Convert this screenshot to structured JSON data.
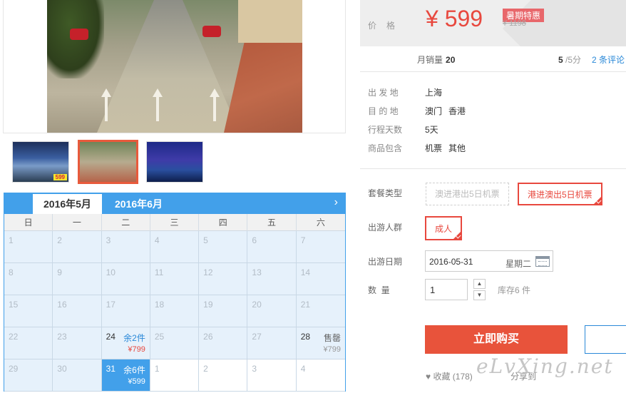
{
  "calendar": {
    "tabs": [
      "2016年5月",
      "2016年6月"
    ],
    "next_icon": "›",
    "weekdays": [
      "日",
      "一",
      "二",
      "三",
      "四",
      "五",
      "六"
    ],
    "cells": [
      {
        "d": "1"
      },
      {
        "d": "2"
      },
      {
        "d": "3"
      },
      {
        "d": "4"
      },
      {
        "d": "5"
      },
      {
        "d": "6"
      },
      {
        "d": "7"
      },
      {
        "d": "8"
      },
      {
        "d": "9"
      },
      {
        "d": "10"
      },
      {
        "d": "11"
      },
      {
        "d": "12"
      },
      {
        "d": "13"
      },
      {
        "d": "14"
      },
      {
        "d": "15"
      },
      {
        "d": "16"
      },
      {
        "d": "17"
      },
      {
        "d": "18"
      },
      {
        "d": "19"
      },
      {
        "d": "20"
      },
      {
        "d": "21"
      },
      {
        "d": "22"
      },
      {
        "d": "23"
      },
      {
        "d": "24",
        "stock": "余2件",
        "price": "¥799"
      },
      {
        "d": "25"
      },
      {
        "d": "26"
      },
      {
        "d": "27"
      },
      {
        "d": "28",
        "stock": "售罄",
        "price": "¥799"
      },
      {
        "d": "29"
      },
      {
        "d": "30"
      },
      {
        "d": "31",
        "stock": "余6件",
        "price": "¥599"
      },
      {
        "d": "1"
      },
      {
        "d": "2"
      },
      {
        "d": "3"
      },
      {
        "d": "4"
      }
    ]
  },
  "thumb_tag": "599",
  "price": {
    "label": "价格",
    "value": "¥ 599",
    "badge": "暑期特惠",
    "original": "¥ 1198"
  },
  "stats": {
    "sales_label": "月销量",
    "sales_value": "20",
    "score_value": "5",
    "score_total": " /5分",
    "reviews": "2 条评论"
  },
  "info": {
    "rows": [
      {
        "k": "出 发 地",
        "v": [
          "上海"
        ]
      },
      {
        "k": "目 的 地",
        "v": [
          "澳门",
          "香港"
        ]
      },
      {
        "k": "行程天数",
        "v": [
          "5天"
        ]
      },
      {
        "k": "商品包含",
        "v": [
          "机票",
          "其他"
        ]
      }
    ]
  },
  "options": {
    "package_label": "套餐类型",
    "package_1": "澳进港出5日机票",
    "package_2": "港进澳出5日机票",
    "crowd_label": "出游人群",
    "crowd_value": "成人",
    "date_label": "出游日期",
    "date_value": "2016-05-31",
    "date_weekday": "星期二",
    "qty_label": "数  量",
    "qty_value": "1",
    "qty_up": "▲",
    "qty_down": "▼",
    "stock_text": "库存6 件"
  },
  "actions": {
    "buy_label": "立即购买",
    "fav_label": "♥ 收藏 (178)",
    "share_label": "分享到"
  },
  "watermark": "eLvXing.net"
}
